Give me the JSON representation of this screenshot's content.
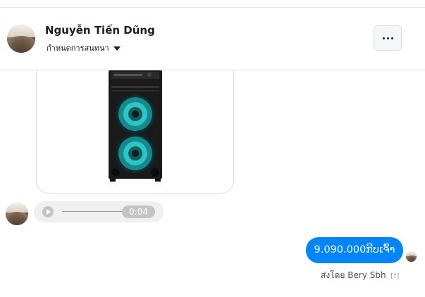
{
  "header": {
    "contact_name": "Nguyễn Tiến Dũng",
    "conversation_settings_label": "กำหนดการสนทนา"
  },
  "audio_message": {
    "duration": "0:04"
  },
  "outgoing_message": {
    "text": "9.090.000ກີບເຈົ້າ"
  },
  "sent_by": {
    "prefix": "ส่งโดย",
    "sender": "Bery Sbh",
    "help": "[?]"
  },
  "colors": {
    "accent": "#0084ff",
    "speaker_glow": "#2fc4c4"
  }
}
